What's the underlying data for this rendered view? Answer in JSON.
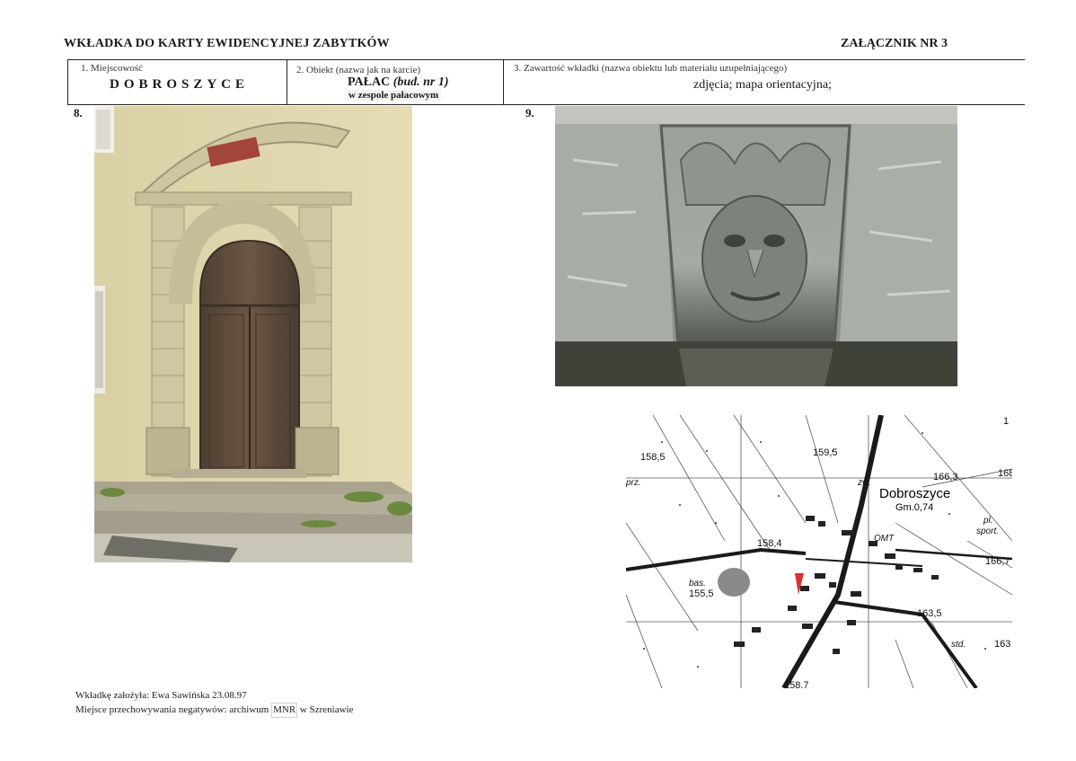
{
  "header": {
    "title": "WKŁADKA DO KARTY EWIDENCYJNEJ ZABYTKÓW",
    "annex": "ZAŁĄCZNIK NR 3"
  },
  "fields": {
    "place_label": "1. Miejscowość",
    "place_value": "DOBROSZYCE",
    "object_label": "2. Obiekt (nazwa jak na karcie)",
    "object_main": "PAŁAC",
    "object_italic": "(bud. nr 1)",
    "object_sub": "w zespole pałacowym",
    "content_label": "3. Zawartość wkładki (nazwa obiektu lub materiału uzupełniającego)",
    "content_value": "zdjęcia; mapa orientacyjna;"
  },
  "photos": {
    "photo8_number": "8.",
    "photo9_number": "9."
  },
  "map": {
    "town_label": "Dobroszyce",
    "gm_label": "Gm.0,74",
    "heights": [
      "158,5",
      "159,5",
      "166,3",
      "168",
      "158,4",
      "155,5",
      "166,7",
      "163,5",
      "163",
      "158,7",
      "1"
    ],
    "words": [
      "prz.",
      "zw.",
      "OMT",
      "pl.",
      "sport.",
      "bas.",
      "std."
    ]
  },
  "footer": {
    "line1": "Wkładkę założyła: Ewa Sawińska  23.08.97",
    "line2_prefix": "Miejsce przechowywania negatywów: archiwum ",
    "line2_mnr": "MNR",
    "line2_suffix": " w Szreniawie"
  }
}
